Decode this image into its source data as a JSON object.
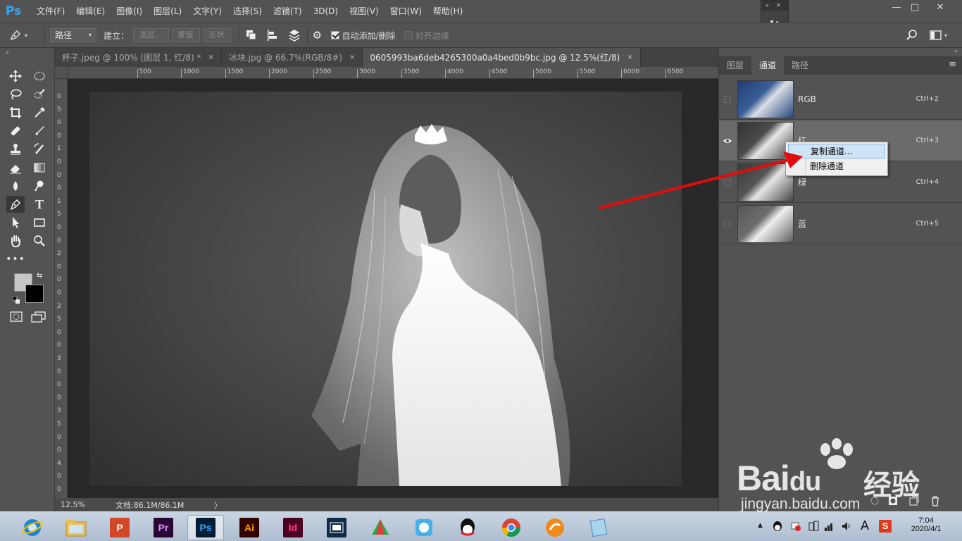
{
  "app": {
    "logo": "Ps"
  },
  "menu": [
    "文件(F)",
    "编辑(E)",
    "图像(I)",
    "图层(L)",
    "文字(Y)",
    "选择(S)",
    "滤镜(T)",
    "3D(D)",
    "视图(V)",
    "窗口(W)",
    "帮助(H)"
  ],
  "window_controls": {
    "minimize": "—",
    "maximize": "□",
    "close": "✕"
  },
  "options": {
    "mode_select": "路径",
    "build_label": "建立：",
    "build_buttons": [
      "选区...",
      "蒙版",
      "形状"
    ],
    "auto_add_delete": "自动添加/删除",
    "align_edges": "对齐边缘"
  },
  "tabs": [
    {
      "label": "杯子.jpeg @ 100% (图层 1, 红/8) *",
      "active": false
    },
    {
      "label": "冰块.jpg @ 66.7%(RGB/8#)",
      "active": false
    },
    {
      "label": "0605993ba6deb4265300a0a4bed0b9bc.jpg @ 12.5%(红/8)",
      "active": true
    }
  ],
  "tab_close": "×",
  "ruler_h": [
    "0",
    "500",
    "1000",
    "1500",
    "2000",
    "2500",
    "3000",
    "3500",
    "4000",
    "4500",
    "5000",
    "5500",
    "6000",
    "6500"
  ],
  "ruler_v": [
    "0",
    "5",
    "0",
    "0",
    "1",
    "0",
    "0",
    "0",
    "1",
    "5",
    "0",
    "0",
    "2",
    "0",
    "0",
    "0",
    "2",
    "5",
    "0",
    "0",
    "3",
    "0",
    "0",
    "0",
    "3",
    "5",
    "0",
    "0",
    "4",
    "0",
    "0",
    "0",
    "4"
  ],
  "status": {
    "zoom": "12.5%",
    "doc": "文档:86.1M/86.1M",
    "arrow": "〉"
  },
  "panel": {
    "tabs": [
      {
        "label": "图层",
        "active": false
      },
      {
        "label": "通道",
        "active": true
      },
      {
        "label": "路径",
        "active": false
      }
    ],
    "menu_icon": "≡",
    "channels": [
      {
        "name": "RGB",
        "shortcut": "Ctrl+2",
        "visible": false,
        "selected": false
      },
      {
        "name": "红",
        "shortcut": "Ctrl+3",
        "visible": true,
        "selected": true
      },
      {
        "name": "绿",
        "shortcut": "Ctrl+4",
        "visible": false,
        "selected": false
      },
      {
        "name": "蓝",
        "shortcut": "Ctrl+5",
        "visible": false,
        "selected": false
      }
    ]
  },
  "context_menu": [
    {
      "label": "复制通道...",
      "highlighted": true
    },
    {
      "label": "删除通道",
      "highlighted": false
    }
  ],
  "taskbar": {
    "apps": [
      {
        "name": "ie",
        "label": ""
      },
      {
        "name": "explorer",
        "label": ""
      },
      {
        "name": "powerpoint",
        "label": "P",
        "color": "#d24726"
      },
      {
        "name": "premiere",
        "label": "Pr",
        "color": "#2a0634"
      },
      {
        "name": "photoshop",
        "label": "Ps",
        "color": "#001d34",
        "active": true
      },
      {
        "name": "illustrator",
        "label": "Ai",
        "color": "#330000"
      },
      {
        "name": "indesign",
        "label": "Id",
        "color": "#49021f"
      },
      {
        "name": "video",
        "label": "",
        "color": "#0f2c46"
      },
      {
        "name": "app-green",
        "label": ""
      },
      {
        "name": "app-blue",
        "label": ""
      },
      {
        "name": "qq",
        "label": ""
      },
      {
        "name": "chrome",
        "label": ""
      },
      {
        "name": "app-orange",
        "label": ""
      },
      {
        "name": "notepad",
        "label": ""
      }
    ],
    "time": "7:04",
    "date": "2020/4/1",
    "lang": "A",
    "tray_caret": "▲"
  },
  "watermark": {
    "brand": "Bai",
    "brand2": "du",
    "cn": "经验",
    "url": "jingyan.baidu.com"
  }
}
